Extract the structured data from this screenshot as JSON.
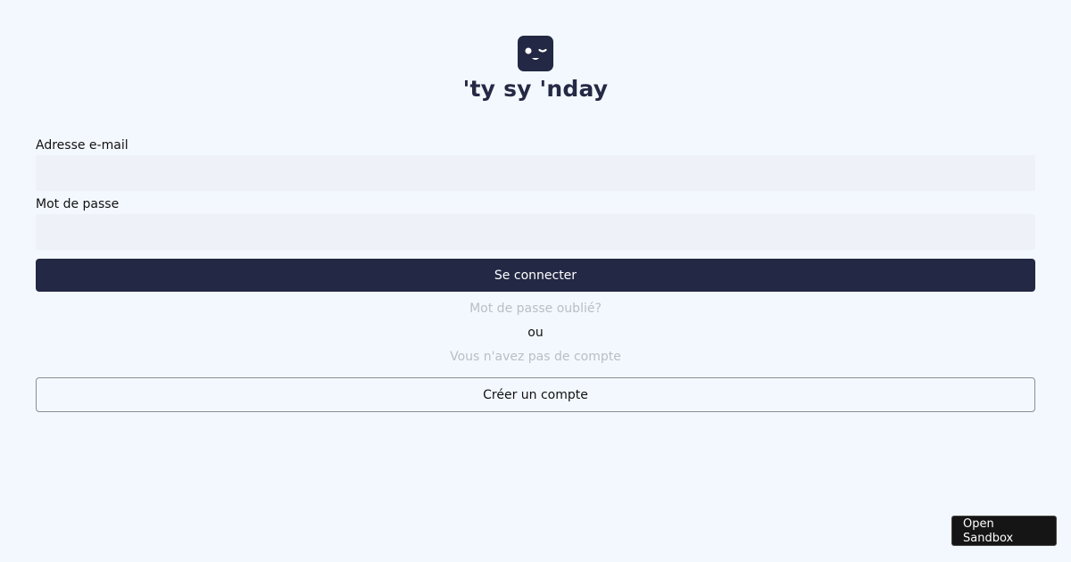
{
  "brand": {
    "logo_icon": "winking-face-icon",
    "name": "'ty sy 'nday",
    "color": "#232844"
  },
  "form": {
    "email_label": "Adresse e-mail",
    "email_value": "",
    "password_label": "Mot de passe",
    "password_value": "",
    "submit_label": "Se connecter",
    "forgot_password": "Mot de passe oublié?",
    "or_text": "ou",
    "no_account": "Vous n'avez pas de compte",
    "create_account_label": "Créer un compte"
  },
  "sandbox": {
    "label": "Open Sandbox"
  }
}
